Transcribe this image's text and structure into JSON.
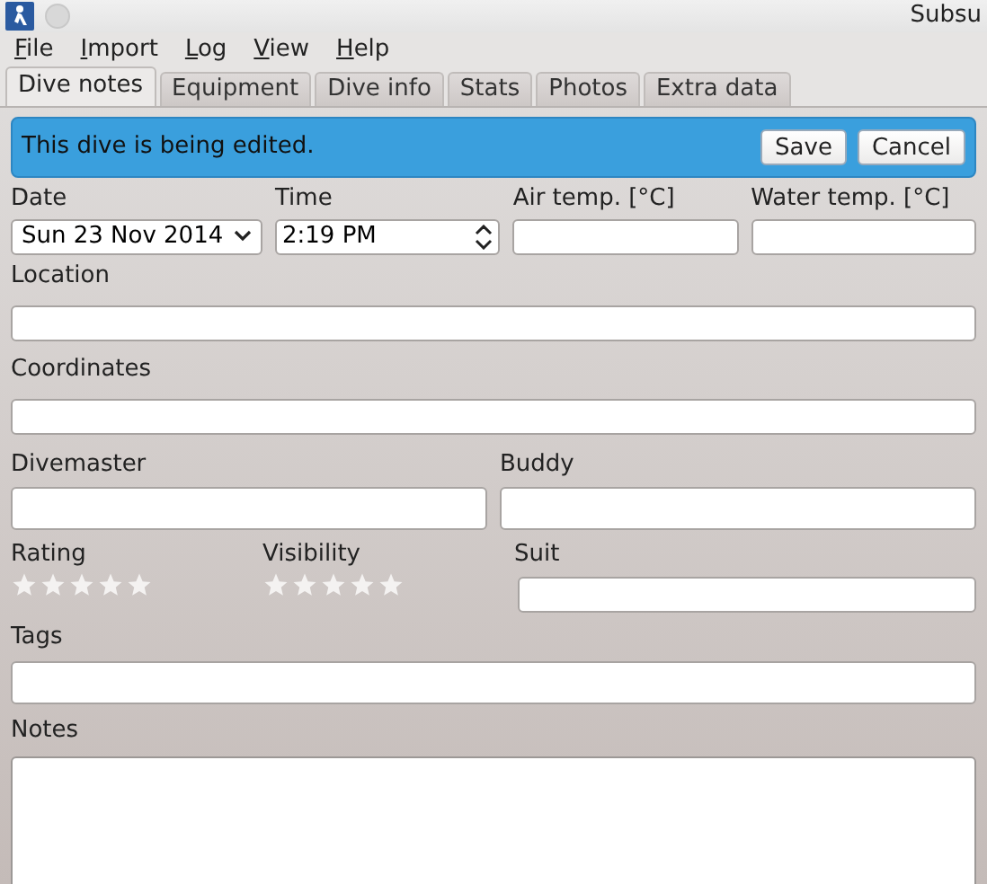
{
  "window": {
    "title": "Subsu"
  },
  "menu": [
    "File",
    "Import",
    "Log",
    "View",
    "Help"
  ],
  "tabs": [
    {
      "label": "Dive notes",
      "selected": true
    },
    {
      "label": "Equipment",
      "selected": false
    },
    {
      "label": "Dive info",
      "selected": false
    },
    {
      "label": "Stats",
      "selected": false
    },
    {
      "label": "Photos",
      "selected": false
    },
    {
      "label": "Extra data",
      "selected": false
    }
  ],
  "banner": {
    "message": "This dive is being edited.",
    "buttons": [
      "Save",
      "Cancel"
    ]
  },
  "fields": {
    "date": {
      "label": "Date",
      "value": "Sun 23 Nov 2014"
    },
    "time": {
      "label": "Time",
      "value": "2:19 PM"
    },
    "air_temp": {
      "label": "Air temp. [°C]"
    },
    "water_temp": {
      "label": "Water temp. [°C]"
    },
    "location": {
      "label": "Location"
    },
    "coordinates": {
      "label": "Coordinates"
    },
    "divemaster": {
      "label": "Divemaster"
    },
    "buddy": {
      "label": "Buddy"
    },
    "rating": {
      "label": "Rating",
      "stars": 0
    },
    "visibility": {
      "label": "Visibility",
      "stars": 0
    },
    "suit": {
      "label": "Suit"
    },
    "tags": {
      "label": "Tags"
    },
    "notes": {
      "label": "Notes"
    }
  }
}
